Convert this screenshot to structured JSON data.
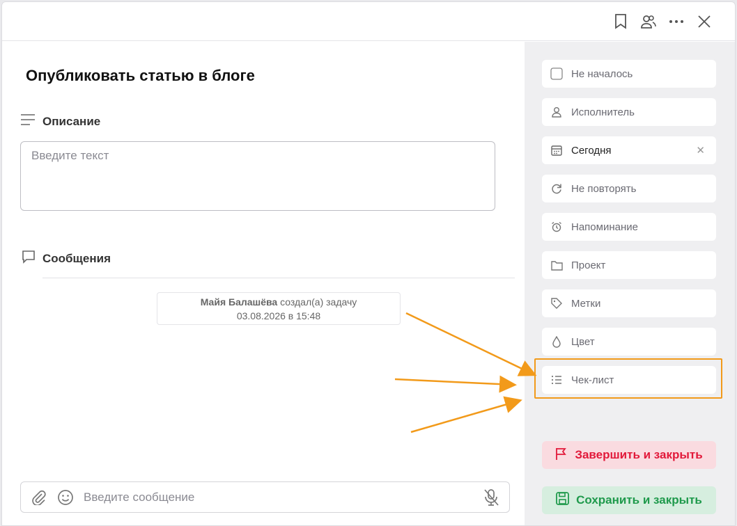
{
  "task": {
    "title": "Опубликовать статью в блоге",
    "description_label": "Описание",
    "description_placeholder": "Введите текст",
    "messages_label": "Сообщения",
    "event": {
      "author": "Майя Балашёва",
      "action": "создал(а) задачу",
      "datetime": "03.08.2026 в 15:48"
    },
    "message_placeholder": "Введите сообщение"
  },
  "sidebar": {
    "status": "Не началось",
    "assignee": "Исполнитель",
    "date": "Сегодня",
    "repeat": "Не повторять",
    "reminder": "Напоминание",
    "project": "Проект",
    "tags": "Метки",
    "color": "Цвет",
    "checklist": "Чек-лист",
    "finish_label": "Завершить и закрыть",
    "save_label": "Сохранить и закрыть"
  },
  "colors": {
    "highlight": "#f29a1a",
    "finish": "#e2193a",
    "save": "#1f9a4c"
  }
}
